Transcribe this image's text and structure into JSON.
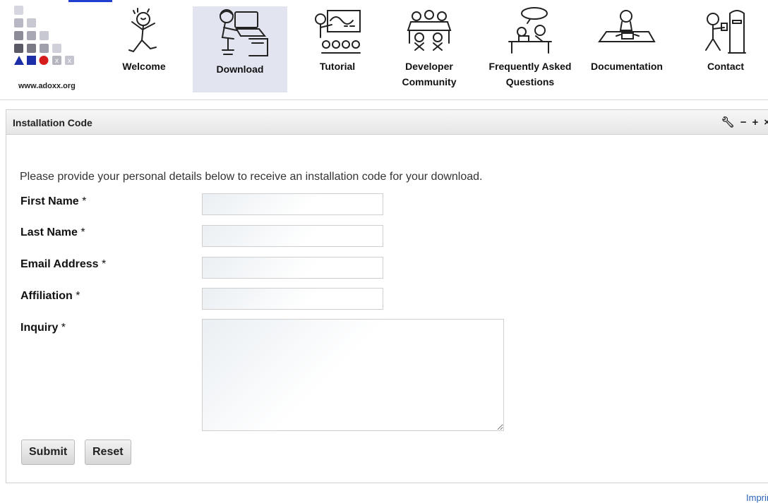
{
  "logo": {
    "url_text": "www.adoxx.org"
  },
  "nav": {
    "items": [
      {
        "label": "Welcome"
      },
      {
        "label": "Download"
      },
      {
        "label": "Tutorial"
      },
      {
        "label": "Developer Community"
      },
      {
        "label": "Frequently Asked Questions"
      },
      {
        "label": "Documentation"
      },
      {
        "label": "Contact"
      }
    ],
    "active_index": 1
  },
  "portlet": {
    "title": "Installation Code",
    "controls": [
      "wrench-icon",
      "minimize-icon",
      "maximize-icon",
      "close-icon"
    ]
  },
  "form": {
    "intro": "Please provide your personal details below to receive an installation code for your download.",
    "fields": {
      "first_name": {
        "label": "First Name",
        "value": ""
      },
      "last_name": {
        "label": "Last Name",
        "value": ""
      },
      "email": {
        "label": "Email Address",
        "value": ""
      },
      "affiliation": {
        "label": "Affiliation",
        "value": ""
      },
      "inquiry": {
        "label": "Inquiry",
        "value": ""
      }
    },
    "required_marker": "*",
    "submit_label": "Submit",
    "reset_label": "Reset"
  },
  "footer": {
    "imprint": "Imprint"
  },
  "colors": {
    "active_nav_bg": "#e2e4f0",
    "link": "#2a62b8",
    "accent_bar": "#1f3fd0"
  }
}
